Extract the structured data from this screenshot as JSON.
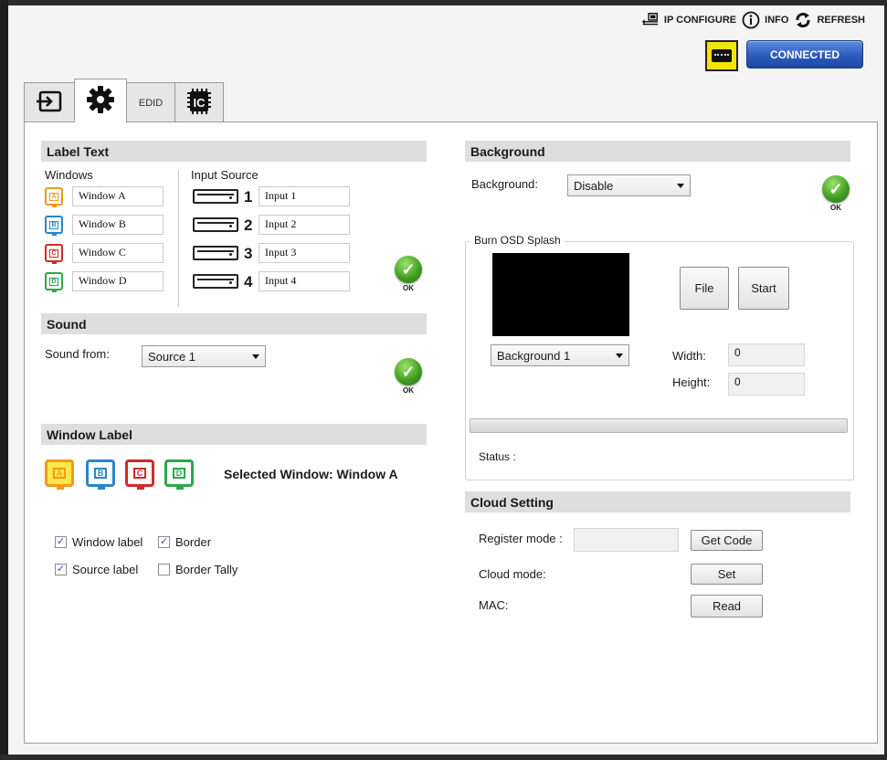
{
  "toolbar": {
    "ip_configure": "IP CONFIGURE",
    "info": "INFO",
    "refresh": "REFRESH",
    "status": "CONNECTED"
  },
  "tabs": [
    {
      "icon": "input-icon",
      "label": ""
    },
    {
      "icon": "gear-icon",
      "label": ""
    },
    {
      "icon": "",
      "label": "EDID"
    },
    {
      "icon": "chip-icon",
      "label": "IC"
    }
  ],
  "label_text": {
    "header": "Label Text",
    "windows_title": "Windows",
    "input_title": "Input Source",
    "windows": [
      {
        "letter": "A",
        "name": "Window A",
        "color": "#f09a1a"
      },
      {
        "letter": "B",
        "name": "Window B",
        "color": "#2a86c9"
      },
      {
        "letter": "C",
        "name": "Window C",
        "color": "#d02a2a"
      },
      {
        "letter": "D",
        "name": "Window D",
        "color": "#2aa84a"
      }
    ],
    "inputs": [
      {
        "num": "1",
        "name": "Input 1"
      },
      {
        "num": "2",
        "name": "Input 2"
      },
      {
        "num": "3",
        "name": "Input 3"
      },
      {
        "num": "4",
        "name": "Input 4"
      }
    ],
    "ok": "OK"
  },
  "sound": {
    "header": "Sound",
    "from_label": "Sound from:",
    "selected": "Source 1",
    "ok": "OK"
  },
  "window_label": {
    "header": "Window Label",
    "selected_text": "Selected Window: Window A",
    "windows": [
      "A",
      "B",
      "C",
      "D"
    ],
    "checkboxes": [
      {
        "label": "Window label",
        "checked": true
      },
      {
        "label": "Border",
        "checked": true
      },
      {
        "label": "Source label",
        "checked": true
      },
      {
        "label": "Border Tally",
        "checked": false
      }
    ]
  },
  "background": {
    "header": "Background",
    "label": "Background:",
    "selected": "Disable",
    "ok": "OK",
    "burn_title": "Burn OSD Splash",
    "file_btn": "File",
    "start_btn": "Start",
    "bg_select": "Background 1",
    "width_label": "Width:",
    "width_value": "0",
    "height_label": "Height:",
    "height_value": "0",
    "status_label": "Status :"
  },
  "cloud": {
    "header": "Cloud Setting",
    "register_label": "Register mode :",
    "register_value": "",
    "get_code_btn": "Get Code",
    "cloud_mode_label": "Cloud mode:",
    "set_btn": "Set",
    "mac_label": "MAC:",
    "read_btn": "Read"
  }
}
